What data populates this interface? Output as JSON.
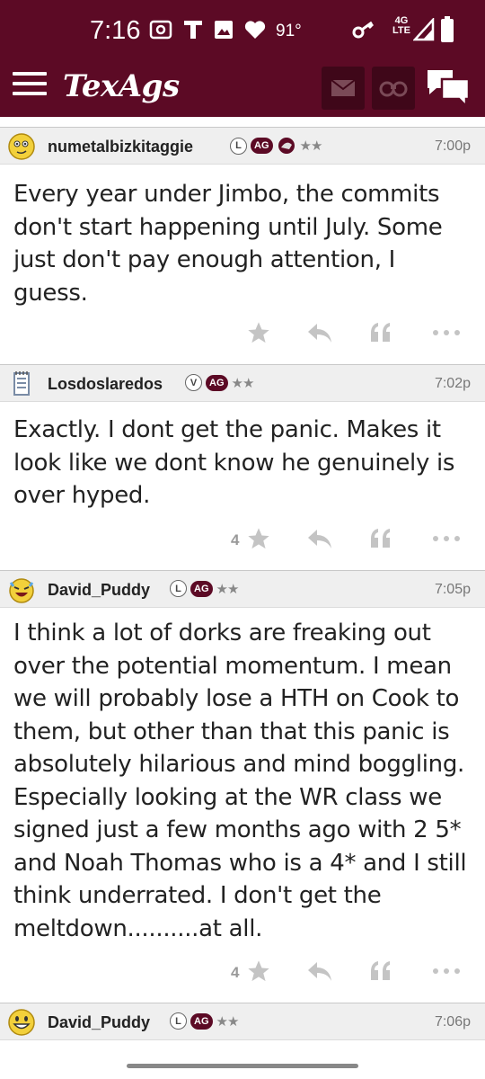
{
  "status_bar": {
    "time": "7:16",
    "temperature": "91°",
    "network": "4G LTE",
    "icons": [
      "cast-icon",
      "t-app-icon",
      "image-icon",
      "heart-icon",
      "key-icon",
      "signal-icon",
      "battery-icon"
    ]
  },
  "header": {
    "logo": "TexAgs",
    "icons": [
      "menu-icon",
      "mail-icon",
      "binoculars-icon",
      "chat-icon"
    ],
    "colors": {
      "maroon": "#5c0a25",
      "dark_maroon": "#3f0719"
    }
  },
  "posts": [
    {
      "username": "numetalbizkitaggie",
      "badges": [
        "L",
        "AG"
      ],
      "stars": "★★",
      "time": "7:00p",
      "avatar": "smiley-face-icon",
      "body": "Every year under Jimbo, the commits don't start happening until July. Some just don't pay enough attention, I guess.",
      "star_count": ""
    },
    {
      "username": "Losdoslaredos",
      "badges": [
        "V",
        "AG"
      ],
      "stars": "★★",
      "time": "7:02p",
      "avatar": "notepad-icon",
      "body": "Exactly. I dont get the panic. Makes it look like we dont know he genuinely is over hyped.",
      "star_count": "4"
    },
    {
      "username": "David_Puddy",
      "badges": [
        "L",
        "AG"
      ],
      "stars": "★★",
      "time": "7:05p",
      "avatar": "laughing-face-icon",
      "body": "I think a lot of dorks are freaking out over the potential momentum. I mean we will probably lose a HTH on Cook to them, but other than that this panic is absolutely hilarious and mind boggling. Especially looking at the WR class we signed just a few months ago with 2 5* and Noah Thomas who is a 4* and I still think underrated. I don't get the meltdown..........at all.",
      "star_count": "4"
    },
    {
      "username": "David_Puddy",
      "badges": [
        "L",
        "AG"
      ],
      "stars": "★★",
      "time": "7:06p",
      "avatar": "grinning-face-icon"
    }
  ]
}
